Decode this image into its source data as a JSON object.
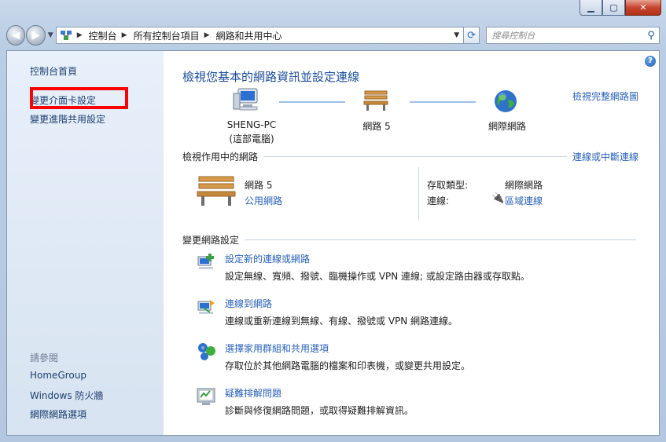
{
  "window": {
    "min_label": "▁",
    "max_label": "▢",
    "close_label": "✕"
  },
  "navbar": {
    "crumbs": [
      "控制台",
      "所有控制台項目",
      "網路和共用中心"
    ],
    "search_placeholder": "搜尋控制台"
  },
  "sidebar": {
    "home": "控制台首頁",
    "change_adapter": "變更介面卡設定",
    "change_sharing": "變更進階共用設定",
    "see_also": "請參閱",
    "homegroup": "HomeGroup",
    "firewall": "Windows 防火牆",
    "internet_options": "網際網路選項"
  },
  "main": {
    "title": "檢視您基本的網路資訊並設定連線",
    "full_map": "檢視完整網路圖",
    "nodes": {
      "pc_name": "SHENG-PC",
      "pc_sub": "(這部電腦)",
      "network": "網路  5",
      "internet": "網際網路"
    },
    "active_header": "檢視作用中的網路",
    "connect_disconnect": "連線或中斷連線",
    "active": {
      "name": "網路  5",
      "type": "公用網路",
      "access_label": "存取類型:",
      "access_value": "網際網路",
      "conn_label": "連線:",
      "conn_value": "區域連線"
    },
    "change_header": "變更網路設定",
    "tasks": [
      {
        "link": "設定新的連線或網路",
        "desc": "設定無線、寬頻、撥號、臨機操作或 VPN 連線; 或設定路由器或存取點。"
      },
      {
        "link": "連線到網路",
        "desc": "連線或重新連線到無線、有線、撥號或 VPN 網路連線。"
      },
      {
        "link": "選擇家用群組和共用選項",
        "desc": "存取位於其他網路電腦的檔案和印表機，或變更共用設定。"
      },
      {
        "link": "疑難排解問題",
        "desc": "診斷與修復網路問題，或取得疑難排解資訊。"
      }
    ]
  }
}
